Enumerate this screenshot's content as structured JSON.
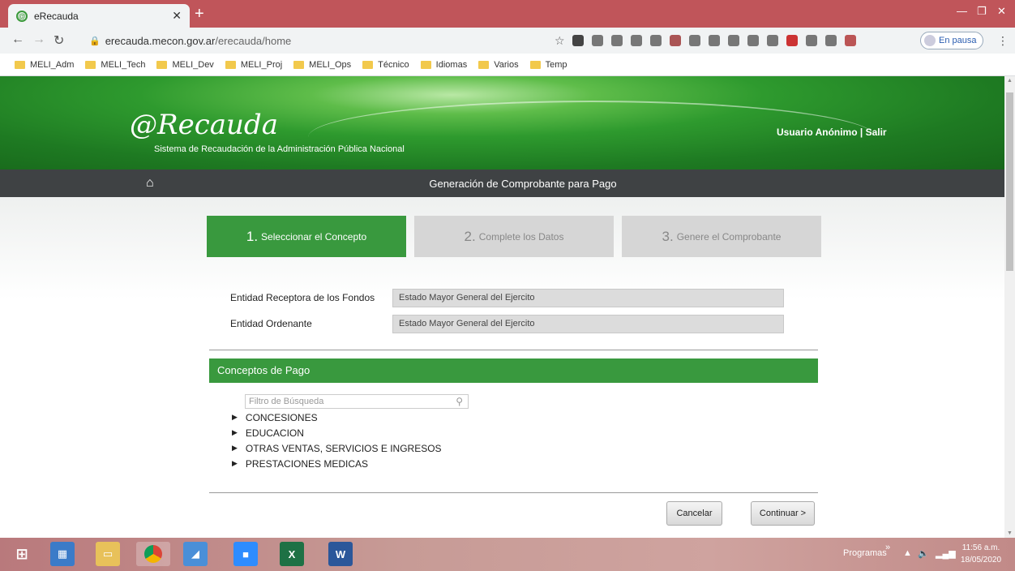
{
  "browser": {
    "tab_title": "eRecauda",
    "url_host": "erecauda.mecon.gov.ar",
    "url_path": "/erecauda/home",
    "profile_status": "En pausa",
    "bookmarks": [
      "MELI_Adm",
      "MELI_Tech",
      "MELI_Dev",
      "MELI_Proj",
      "MELI_Ops",
      "Técnico",
      "Idiomas",
      "Varios",
      "Temp"
    ]
  },
  "header": {
    "logo": "@Recauda",
    "subtitle": "Sistema de Recaudación de la Administración Pública Nacional",
    "user_links": "Usuario Anónimo | Salir",
    "nav_title": "Generación de Comprobante para Pago"
  },
  "steps": [
    {
      "num": "1.",
      "label": "Seleccionar el Concepto"
    },
    {
      "num": "2.",
      "label": "Complete los Datos"
    },
    {
      "num": "3.",
      "label": "Genere el Comprobante"
    }
  ],
  "fields": {
    "receptora_label": "Entidad Receptora de los Fondos",
    "receptora_value": "Estado Mayor General del Ejercito",
    "ordenante_label": "Entidad Ordenante",
    "ordenante_value": "Estado Mayor General del Ejercito"
  },
  "conceptos": {
    "header": "Conceptos de Pago",
    "filter_placeholder": "Filtro de Búsqueda",
    "items": [
      "CONCESIONES",
      "EDUCACION",
      "OTRAS VENTAS, SERVICIOS E INGRESOS",
      "PRESTACIONES MEDICAS"
    ]
  },
  "actions": {
    "cancel": "Cancelar",
    "continue": "Continuar >"
  },
  "taskbar": {
    "programas": "Programas",
    "time": "11:56 a.m.",
    "date": "18/05/2020"
  },
  "colors": {
    "accent_green": "#39993e",
    "navbar": "#3f4244",
    "titlebar": "#c0555a"
  }
}
